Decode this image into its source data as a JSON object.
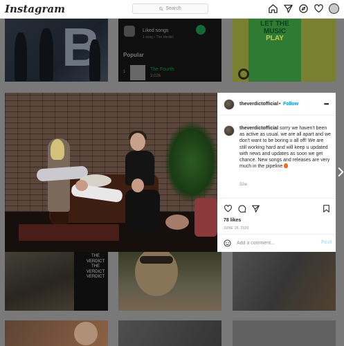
{
  "app": {
    "logo": "Instagram"
  },
  "search": {
    "placeholder": "Search"
  },
  "nav": {
    "icons": [
      "home-icon",
      "direct-icon",
      "explore-icon",
      "activity-icon",
      "profile-avatar"
    ]
  },
  "grid_tiles": {
    "spotify": {
      "liked_title": "Liked songs",
      "liked_sub": "1 song • The Verdict",
      "popular": "Popular",
      "rank": "1",
      "track": "The Fourth",
      "plays": "3,026"
    },
    "poster": {
      "line1": "LET THE",
      "line2": "MUSIC",
      "line3": "PLAY"
    },
    "shirt": {
      "line1": "THE VERDICT",
      "line2": "THE VERDICT",
      "line3": "VERDICT"
    }
  },
  "post": {
    "username": "theverdictofficial",
    "separator": "•",
    "follow_label": "Follow",
    "more_label": "•••",
    "caption_user": "theverdictofficial",
    "caption_text": " sorry we haven't been as active as usual. we are all apart and we don't want to be boring u all off! We are still working hard and will keep u updated with news and updates as soon we get chance. New songs and releases are very much in the pipeline ",
    "time_ago": "32w",
    "likes": "78 likes",
    "date": "JUNE 18, 2020",
    "comment_placeholder": "Add a comment...",
    "post_label": "Post"
  },
  "colors": {
    "accent_blue": "#0095f6",
    "post_disabled": "#b2dffc"
  }
}
